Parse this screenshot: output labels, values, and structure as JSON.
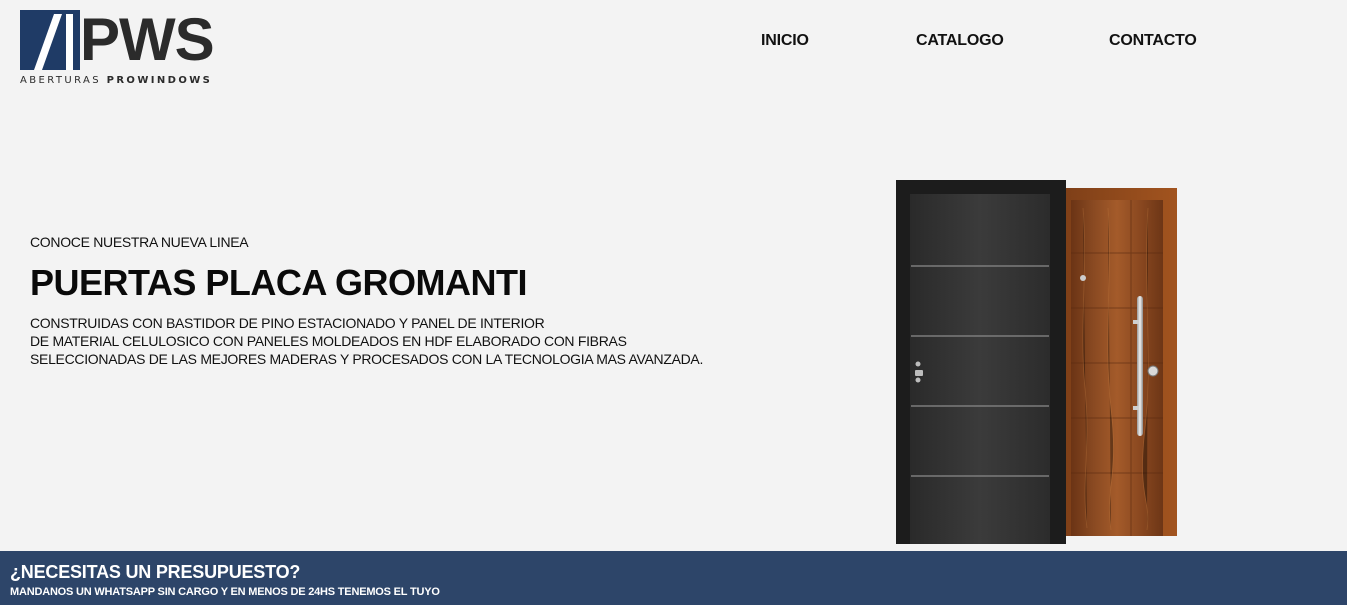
{
  "brand": {
    "logo_text": "PWS",
    "logo_sub_light": "ABERTURAS",
    "logo_sub_bold": "PROWINDOWS",
    "colors": {
      "primary": "#1f3b66",
      "dark": "#2b2b2b"
    }
  },
  "nav": {
    "items": [
      {
        "label": "INICIO"
      },
      {
        "label": "CATALOGO"
      },
      {
        "label": "CONTACTO"
      }
    ]
  },
  "hero": {
    "kicker": "CONOCE NUESTRA NUEVA LINEA",
    "title": "PUERTAS PLACA GROMANTI",
    "description_lines": [
      "CONSTRUIDAS CON BASTIDOR DE PINO ESTACIONADO Y PANEL DE INTERIOR",
      "DE MATERIAL CELULOSICO CON PANELES MOLDEADOS EN HDF ELABORADO CON FIBRAS",
      "SELECCIONADAS DE LAS MEJORES MADERAS Y PROCESADOS CON LA TECNOLOGIA MAS AVANZADA."
    ]
  },
  "banner": {
    "title": "¿NECESITAS UN PRESUPUESTO?",
    "subtitle": "MANDANOS UN WHATSAPP SIN CARGO Y EN MENOS DE 24HS TENEMOS EL TUYO",
    "color": "#2d4569"
  }
}
